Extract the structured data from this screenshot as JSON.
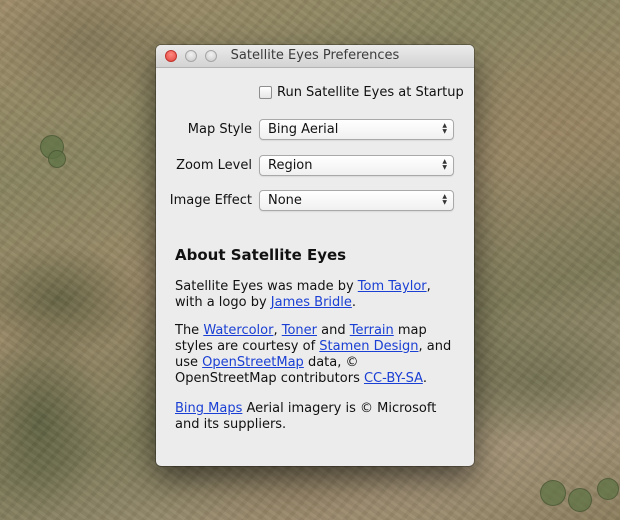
{
  "window": {
    "title": "Satellite Eyes Preferences"
  },
  "startup": {
    "label": "Run Satellite Eyes at Startup",
    "checked": false
  },
  "settings": [
    {
      "label": "Map Style",
      "value": "Bing Aerial"
    },
    {
      "label": "Zoom Level",
      "value": "Region"
    },
    {
      "label": "Image Effect",
      "value": "None"
    }
  ],
  "about": {
    "title": "About Satellite Eyes",
    "p1": {
      "t1": "Satellite Eyes was made by ",
      "link1": "Tom Taylor",
      "t2": ", with a logo by ",
      "link2": "James Bridle",
      "t3": "."
    },
    "p2": {
      "t1": "The ",
      "link1": "Watercolor",
      "t2": ", ",
      "link2": "Toner",
      "t3": " and ",
      "link3": "Terrain",
      "t4": " map styles are courtesy of ",
      "link4": "Stamen Design",
      "t5": ", and use ",
      "link5": "OpenStreetMap",
      "t6": " data, © OpenStreetMap contributors ",
      "link6": "CC-BY-SA",
      "t7": "."
    },
    "p3": {
      "link1": "Bing Maps",
      "t1": " Aerial imagery is © Microsoft and its suppliers."
    }
  }
}
